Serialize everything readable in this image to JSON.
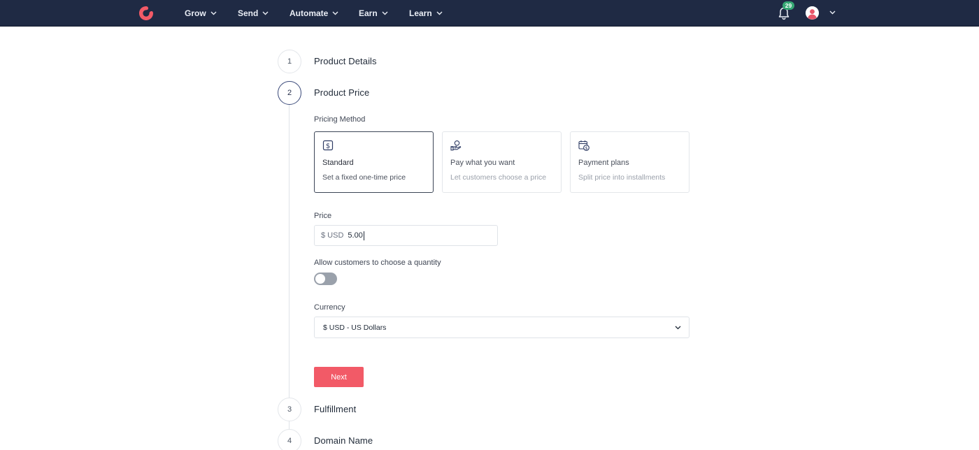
{
  "nav": {
    "items": [
      {
        "label": "Grow"
      },
      {
        "label": "Send"
      },
      {
        "label": "Automate"
      },
      {
        "label": "Earn"
      },
      {
        "label": "Learn"
      }
    ],
    "notification_count": "29",
    "colors": {
      "bar": "#1f2a44",
      "logo": "#f25a67",
      "badge": "#36a874"
    }
  },
  "steps": [
    {
      "number": "1",
      "title": "Product Details"
    },
    {
      "number": "2",
      "title": "Product Price"
    },
    {
      "number": "3",
      "title": "Fulfillment"
    },
    {
      "number": "4",
      "title": "Domain Name"
    }
  ],
  "form": {
    "pricing_method_label": "Pricing Method",
    "pricing_options": [
      {
        "title": "Standard",
        "description": "Set a fixed one-time price",
        "icon": "dollar-square-icon",
        "selected": true
      },
      {
        "title": "Pay what you want",
        "description": "Let customers choose a price",
        "icon": "hand-coin-icon",
        "selected": false
      },
      {
        "title": "Payment plans",
        "description": "Split price into installments",
        "icon": "calendar-dollar-icon",
        "selected": false
      }
    ],
    "price_label": "Price",
    "price_prefix": "$ USD",
    "price_value": "5.00",
    "quantity_label": "Allow customers to choose a quantity",
    "quantity_enabled": false,
    "currency_label": "Currency",
    "currency_value": "$ USD - US Dollars",
    "next_label": "Next",
    "accent_color": "#f25a67"
  }
}
